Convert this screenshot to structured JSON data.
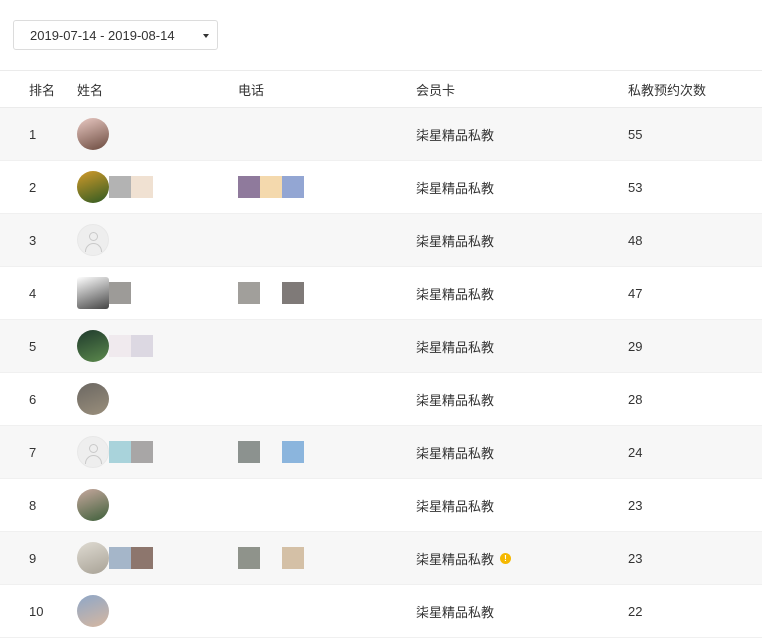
{
  "filter": {
    "date_range": "2019-07-14 - 2019-08-14",
    "caret_icon": "caret-down-icon"
  },
  "table": {
    "headers": {
      "rank": "排名",
      "name": "姓名",
      "phone": "电话",
      "card": "会员卡",
      "count": "私教预约次数"
    },
    "rows": [
      {
        "rank": "1",
        "card": "柒星精品私教",
        "count": "55",
        "avatar_colors": [
          "#e9c9c3",
          "#6b4a3e"
        ],
        "name_blocks": [],
        "phone_blocks": [],
        "warning": false
      },
      {
        "rank": "2",
        "card": "柒星精品私教",
        "count": "53",
        "avatar_colors": [
          "#d29a2a",
          "#2f5a22"
        ],
        "name_blocks": [
          "#b3b3b3",
          "#f0e1d2"
        ],
        "phone_blocks": [
          "#8f7a9c",
          "#f4d9ad",
          "#93a6d3"
        ],
        "warning": false
      },
      {
        "rank": "3",
        "card": "柒星精品私教",
        "count": "48",
        "avatar_colors": [],
        "name_blocks": [],
        "phone_blocks": [],
        "warning": false
      },
      {
        "rank": "4",
        "card": "柒星精品私教",
        "count": "47",
        "avatar_colors": [
          "#ffffff",
          "#444444"
        ],
        "name_blocks": [
          "#9d9b98"
        ],
        "phone_blocks": [
          "#a19f9b",
          "#7f7a78"
        ],
        "warning": false
      },
      {
        "rank": "5",
        "card": "柒星精品私教",
        "count": "29",
        "avatar_colors": [
          "#1f3a2c",
          "#5c8a4d"
        ],
        "name_blocks": [
          "#f0eaee",
          "#dcd8e2"
        ],
        "phone_blocks": [],
        "warning": false
      },
      {
        "rank": "6",
        "card": "柒星精品私教",
        "count": "28",
        "avatar_colors": [
          "#6b6762",
          "#9a8f7c"
        ],
        "name_blocks": [],
        "phone_blocks": [],
        "warning": false
      },
      {
        "rank": "7",
        "card": "柒星精品私教",
        "count": "24",
        "avatar_colors": [],
        "name_blocks": [
          "#a9d3db",
          "#a8a6a6"
        ],
        "phone_blocks": [
          "#8c928f",
          "#8bb5dd"
        ],
        "warning": false
      },
      {
        "rank": "8",
        "card": "柒星精品私教",
        "count": "23",
        "avatar_colors": [
          "#c7a89e",
          "#3e5f3a"
        ],
        "name_blocks": [],
        "phone_blocks": [],
        "warning": false
      },
      {
        "rank": "9",
        "card": "柒星精品私教",
        "count": "23",
        "avatar_colors": [
          "#dfdbd2",
          "#a8a296"
        ],
        "name_blocks": [
          "#a5b6c9",
          "#8d766d"
        ],
        "phone_blocks": [
          "#8f938b",
          "#d4c0a6"
        ],
        "warning": true
      },
      {
        "rank": "10",
        "card": "柒星精品私教",
        "count": "22",
        "avatar_colors": [
          "#8ea7c8",
          "#d6b7a0"
        ],
        "name_blocks": [],
        "phone_blocks": [],
        "warning": false
      }
    ]
  },
  "colors": {
    "row_stripe": "#f7f7f7",
    "warning": "#f5b800"
  }
}
